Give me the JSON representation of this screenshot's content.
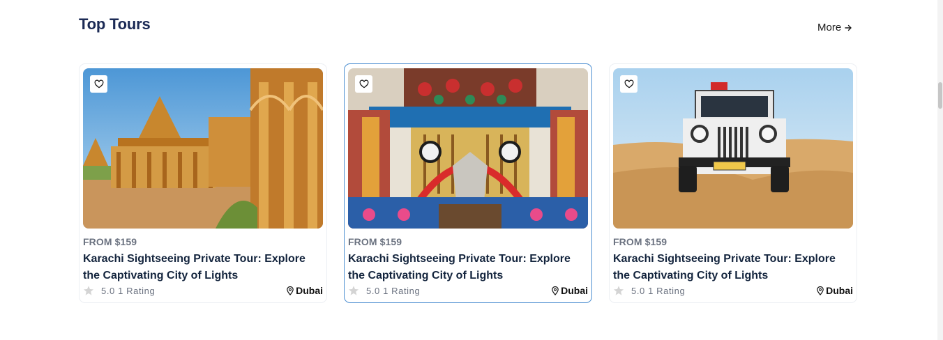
{
  "section": {
    "title": "Top Tours",
    "more_label": "More"
  },
  "cards": [
    {
      "price": "FROM $159",
      "title": "Karachi Sightseeing Private Tour: Explore the Captivating City of Lights",
      "rating_text": "5.0 1 Rating",
      "location": "Dubai",
      "image": "desert-palace-cenotaphs"
    },
    {
      "price": "FROM $159",
      "title": "Karachi Sightseeing Private Tour: Explore the Captivating City of Lights",
      "rating_text": "5.0 1 Rating",
      "location": "Dubai",
      "image": "decorated-truck"
    },
    {
      "price": "FROM $159",
      "title": "Karachi Sightseeing Private Tour: Explore the Captivating City of Lights",
      "rating_text": "5.0 1 Rating",
      "location": "Dubai",
      "image": "desert-jeep"
    }
  ],
  "colors": {
    "title": "#1b2a55",
    "card_border": "#eceff3",
    "active_border": "#4d8fd1",
    "price": "#6b7280",
    "tour_title": "#13243d"
  }
}
